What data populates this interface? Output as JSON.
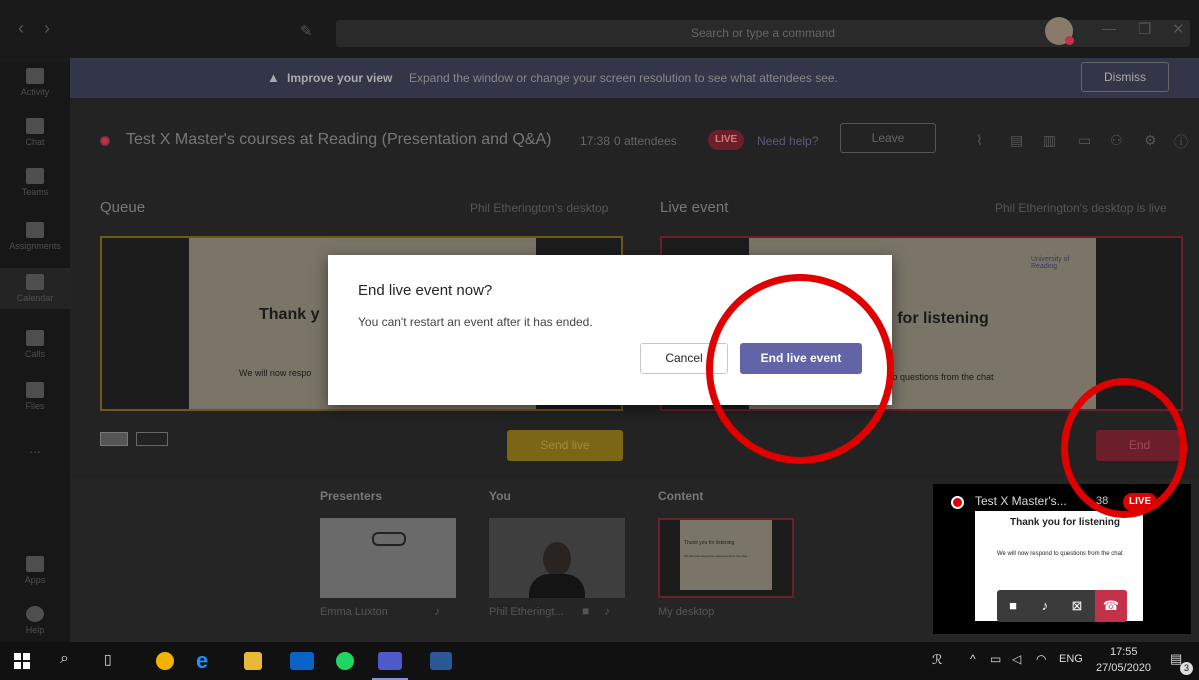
{
  "topbar": {
    "nav_back": "‹",
    "nav_forward": "›",
    "compose_icon": "✎",
    "search_placeholder": "Search or type a command",
    "minimize": "—",
    "maximize": "❐",
    "close": "✕"
  },
  "rail": {
    "items": [
      {
        "label": "Activity",
        "icon": "bell-icon"
      },
      {
        "label": "Chat",
        "icon": "chat-icon"
      },
      {
        "label": "Teams",
        "icon": "teams-icon"
      },
      {
        "label": "Assignments",
        "icon": "assignments-icon"
      },
      {
        "label": "Calendar",
        "icon": "calendar-icon"
      },
      {
        "label": "Calls",
        "icon": "phone-icon"
      },
      {
        "label": "Files",
        "icon": "file-icon"
      },
      {
        "label": "...",
        "icon": "more-icon"
      },
      {
        "label": "Apps",
        "icon": "apps-icon"
      },
      {
        "label": "Help",
        "icon": "help-icon"
      }
    ]
  },
  "banner": {
    "bold": "Improve your view",
    "text": "Expand the window or change your screen resolution to see what attendees see.",
    "dismiss": "Dismiss"
  },
  "event": {
    "title": "Test X Master's courses at Reading (Presentation and Q&A)",
    "time": "17:38",
    "attendees": "0 attendees",
    "live": "LIVE",
    "help": "Need help?",
    "leave": "Leave"
  },
  "queue": {
    "heading": "Queue",
    "source": "Phil Etherington's desktop",
    "slide_title": "Thank y",
    "slide_sub": "We will now respo",
    "send_live": "Send live"
  },
  "live": {
    "heading": "Live event",
    "source": "Phil Etherington's desktop is live",
    "logo": "University of Reading",
    "slide_title": "u for listening",
    "slide_sub": "to questions from the chat",
    "end": "End"
  },
  "sources": {
    "presenters_heading": "Presenters",
    "you_heading": "You",
    "content_heading": "Content",
    "presenter_name": "Emma Luxton",
    "you_name": "Phil Etheringt...",
    "content_name": "My desktop",
    "content_title": "Thank you for listening",
    "content_sub": "We will now respond to questions from the chat"
  },
  "mini_window": {
    "title": "Test X Master's...",
    "time": "38",
    "live": "LIVE",
    "slide_title": "Thank you for listening",
    "slide_sub": "We will now respond to questions from the chat"
  },
  "dialog": {
    "title": "End live event now?",
    "body": "You can't restart an event after it has ended.",
    "cancel": "Cancel",
    "confirm": "End live event"
  },
  "taskbar": {
    "lang": "ENG",
    "time": "17:55",
    "date": "27/05/2020",
    "notifications": "3"
  },
  "colors": {
    "accent": "#6264a7",
    "live_red": "#c4314b",
    "annotation_red": "#e00000",
    "send_live": "#7a6614",
    "end_button": "#6b1f2b"
  }
}
